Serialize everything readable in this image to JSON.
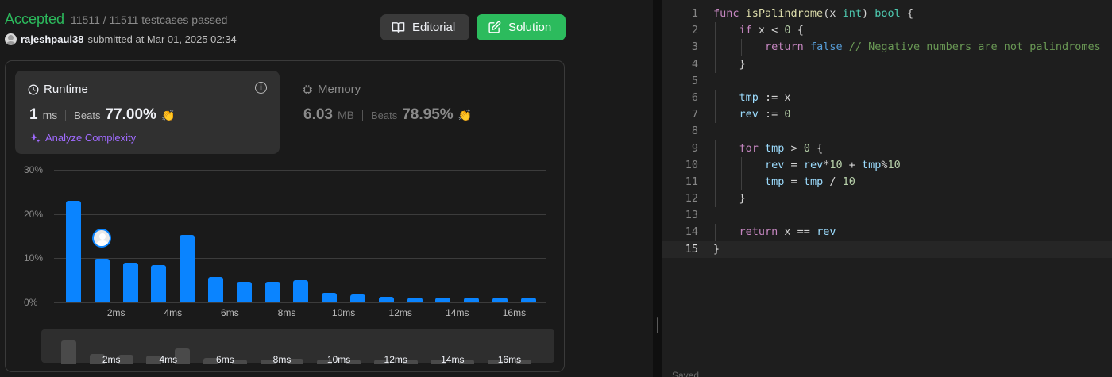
{
  "result": {
    "status": "Accepted",
    "testcases": "11511 / 11511 testcases passed",
    "username": "rajeshpaul38",
    "submitted": "submitted at Mar 01, 2025 02:34"
  },
  "buttons": {
    "editorial": "Editorial",
    "solution": "Solution"
  },
  "runtime": {
    "title": "Runtime",
    "value": "1",
    "unit": "ms",
    "beats_label": "Beats",
    "beats": "77.00%",
    "analyze": "Analyze Complexity"
  },
  "memory": {
    "title": "Memory",
    "value": "6.03",
    "unit": "MB",
    "beats_label": "Beats",
    "beats": "78.95%"
  },
  "colors": {
    "accepted": "#2cbb5d",
    "bar": "#0a84ff",
    "analyze": "#a06bff"
  },
  "chart_data": {
    "type": "bar",
    "x": [
      1,
      2,
      3,
      4,
      5,
      6,
      7,
      8,
      9,
      10,
      11,
      12,
      13,
      14,
      15,
      16,
      17
    ],
    "values": [
      23,
      9.8,
      8.9,
      8.4,
      15.2,
      5.8,
      4.7,
      4.6,
      5.1,
      2.2,
      1.8,
      1.3,
      1.0,
      1.0,
      1.0,
      1.0,
      1.0
    ],
    "y_ticks": [
      "30%",
      "20%",
      "10%",
      "0%"
    ],
    "x_ticks": [
      "2ms",
      "4ms",
      "6ms",
      "8ms",
      "10ms",
      "12ms",
      "14ms",
      "16ms"
    ],
    "ylim": [
      0,
      30
    ],
    "user_bucket": 2
  },
  "mini_chart": {
    "values": [
      23,
      9.8,
      8.9,
      8.4,
      15.2,
      5.8,
      4.7,
      4.6,
      5.1,
      2.2,
      1.8,
      1.3,
      1.0,
      1.0,
      1.0,
      1.0,
      1.0
    ],
    "x_ticks": [
      "2ms",
      "4ms",
      "6ms",
      "8ms",
      "10ms",
      "12ms",
      "14ms",
      "16ms"
    ]
  },
  "editor": {
    "lines": [
      "func isPalindrome(x int) bool {",
      "    if x < 0 {",
      "        return false // Negative numbers are not palindromes",
      "    }",
      "",
      "    tmp := x",
      "    rev := 0",
      "",
      "    for tmp > 0 {",
      "        rev = rev*10 + tmp%10",
      "        tmp = tmp / 10",
      "    }",
      "",
      "    return x == rev",
      "}"
    ],
    "active_line": 15,
    "footer": "Saved"
  }
}
